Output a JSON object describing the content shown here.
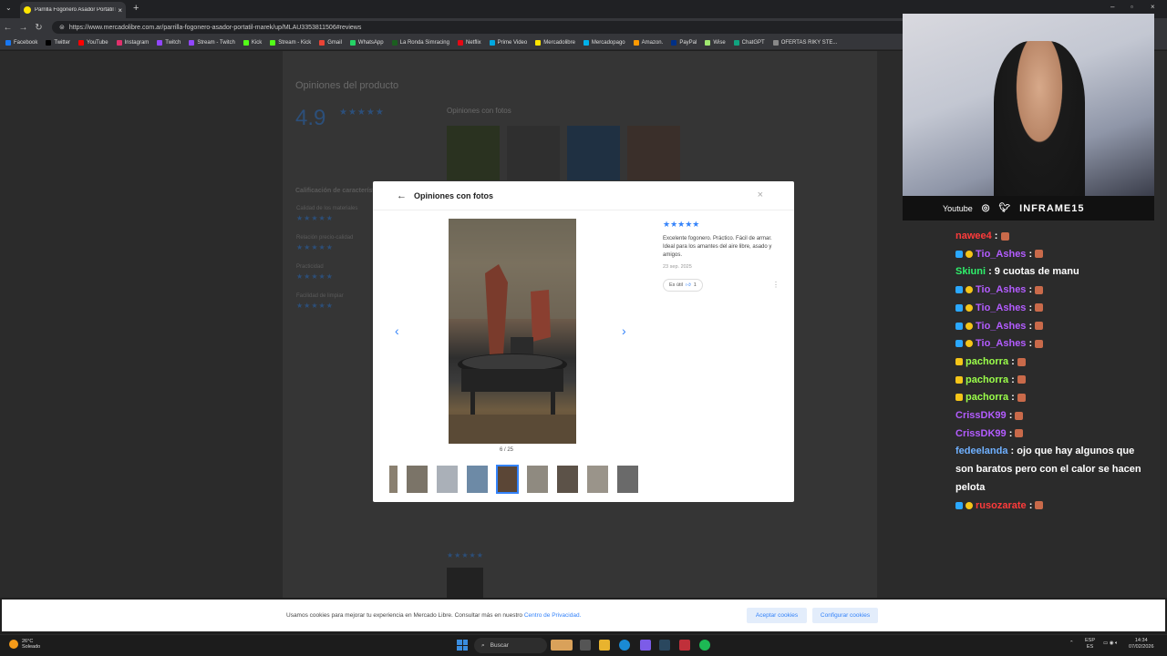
{
  "browser": {
    "tab_title": "Parrilla Fogonero Asador Portátil M",
    "url": "https://www.mercadolibre.com.ar/parrilla-fogonero-asador-portatil-marek/up/MLAU3353811506#reviews",
    "bookmarks": [
      "Facebook",
      "Twitter",
      "YouTube",
      "Instagram",
      "Twitch",
      "Stream - Twitch",
      "Kick",
      "Stream - Kick",
      "Gmail",
      "WhatsApp",
      "La Ronda Simracing",
      "Netflix",
      "Prime Video",
      "Mercadolibre",
      "Mercadopago",
      "Amazon.",
      "PayPal",
      "Wise",
      "ChatGPT",
      "OFERTAS RIKY STE..."
    ]
  },
  "background_page": {
    "section_title": "Opiniones del producto",
    "avg_rating": "4.9",
    "photos_heading": "Opiniones con fotos",
    "features_heading": "Calificación de características",
    "features": [
      "Calidad de los materiales",
      "Relación precio-calidad",
      "Practicidad",
      "Facilidad de limpiar"
    ]
  },
  "modal": {
    "title": "Opiniones con fotos",
    "photo_counter": "6 / 25",
    "review": {
      "stars": "★★★★★",
      "text": "Excelente fogonero. Práctico. Fácil de armar. Ideal para los amantes del aire libre, asado y amigos.",
      "date": "23 sep. 2025",
      "useful_label": "Es útil",
      "useful_count": "1"
    },
    "thumbnail_count": 9,
    "active_thumbnail": 5
  },
  "cookie_banner": {
    "text": "Usamos cookies para mejorar tu experiencia en Mercado Libre. Consultar más en nuestro",
    "link": "Centro de Privacidad.",
    "accept": "Aceptar cookies",
    "configure": "Configurar cookies"
  },
  "taskbar": {
    "temp": "26°C",
    "weather": "Soleado",
    "search": "Buscar",
    "lang": "ESP",
    "lang2": "ES",
    "time": "14:34",
    "date": "07/02/2026"
  },
  "stream": {
    "platform": "Youtube",
    "brand": "INFRAME15"
  },
  "chat": [
    {
      "user": "nawee4",
      "color": "#ff3b3b",
      "msg": "",
      "emote": true,
      "badges": 0
    },
    {
      "user": "Tio_Ashes",
      "color": "#b35cff",
      "msg": "",
      "emote": true,
      "badges": 2
    },
    {
      "user": "Skiuni",
      "color": "#2ff06b",
      "msg": "9 cuotas de manu",
      "emote": false,
      "badges": 0
    },
    {
      "user": "Tio_Ashes",
      "color": "#b35cff",
      "msg": "",
      "emote": true,
      "badges": 2
    },
    {
      "user": "Tio_Ashes",
      "color": "#b35cff",
      "msg": "",
      "emote": true,
      "badges": 2
    },
    {
      "user": "Tio_Ashes",
      "color": "#b35cff",
      "msg": "",
      "emote": true,
      "badges": 2
    },
    {
      "user": "Tio_Ashes",
      "color": "#b35cff",
      "msg": "",
      "emote": true,
      "badges": 2
    },
    {
      "user": "pachorra",
      "color": "#9bff4a",
      "msg": "",
      "emote": true,
      "badges": 1
    },
    {
      "user": "pachorra",
      "color": "#9bff4a",
      "msg": "",
      "emote": true,
      "badges": 1
    },
    {
      "user": "pachorra",
      "color": "#9bff4a",
      "msg": "",
      "emote": true,
      "badges": 1
    },
    {
      "user": "CrissDK99",
      "color": "#b35cff",
      "msg": "",
      "emote": true,
      "badges": 0
    },
    {
      "user": "CrissDK99",
      "color": "#b35cff",
      "msg": "",
      "emote": true,
      "badges": 0
    },
    {
      "user": "fedeelanda",
      "color": "#6fb0ff",
      "msg": "ojo que hay algunos que son baratos pero con el calor se hacen pelota",
      "emote": false,
      "badges": 0
    },
    {
      "user": "rusozarate",
      "color": "#ff3b3b",
      "msg": "",
      "emote": true,
      "badges": 2
    }
  ]
}
